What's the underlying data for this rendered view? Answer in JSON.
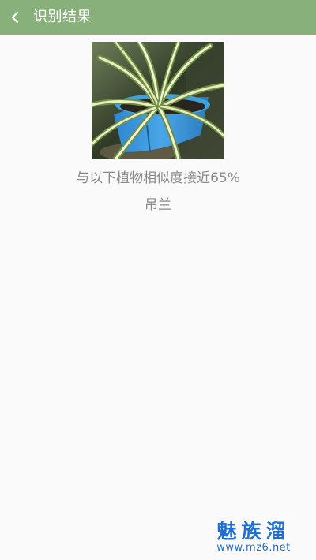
{
  "header": {
    "title": "识别结果",
    "back_icon": "chevron-left-icon",
    "background_color": "#88b07a"
  },
  "result": {
    "similarity_text": "与以下植物相似度接近65%",
    "similarity_percent": 65,
    "plant_name": "吊兰"
  },
  "watermark": {
    "title": "魅族溜",
    "url": "www.mz6.net"
  }
}
